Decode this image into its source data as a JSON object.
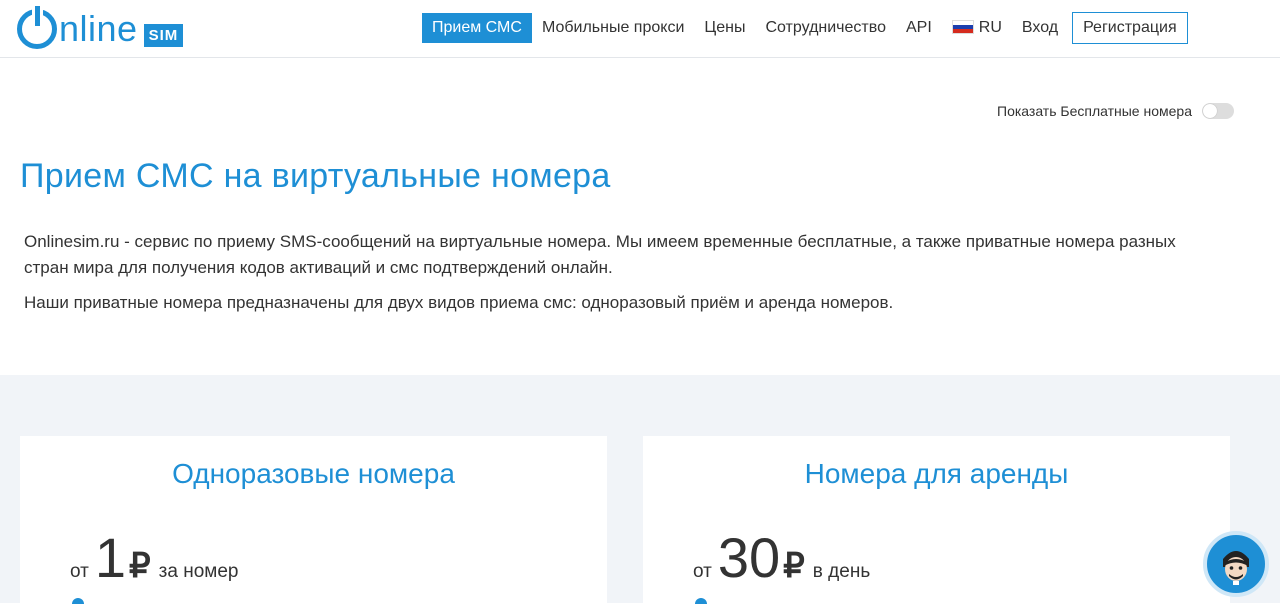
{
  "brand": {
    "logo_word": "nline",
    "logo_badge": "SIM",
    "accent_color": "#1e8fd5"
  },
  "nav": {
    "items": [
      {
        "label": "Прием СМС",
        "active": true
      },
      {
        "label": "Мобильные прокси"
      },
      {
        "label": "Цены"
      },
      {
        "label": "Сотрудничество"
      },
      {
        "label": "API"
      }
    ],
    "language": "RU",
    "login": "Вход",
    "register": "Регистрация"
  },
  "toggle": {
    "label": "Показать Бесплатные номера",
    "on": false
  },
  "main": {
    "title": "Прием СМС на виртуальные номера",
    "intro": "Onlinesim.ru - сервис по приему SMS-сообщений на виртуальные номера. Мы имеем временные бесплатные, а также приватные номера разных стран мира для получения кодов активаций и смс подтверждений онлайн.",
    "intro2": "Наши приватные номера предназначены для двух видов приема смс: одноразовый приём и аренда номеров."
  },
  "cards": [
    {
      "title": "Одноразовые номера",
      "from": "от",
      "price": "1",
      "currency": "₽",
      "unit": "за номер"
    },
    {
      "title": "Номера для аренды",
      "from": "от",
      "price": "30",
      "currency": "₽",
      "unit": "в день"
    }
  ],
  "chat": {
    "icon": "support-avatar-icon"
  }
}
